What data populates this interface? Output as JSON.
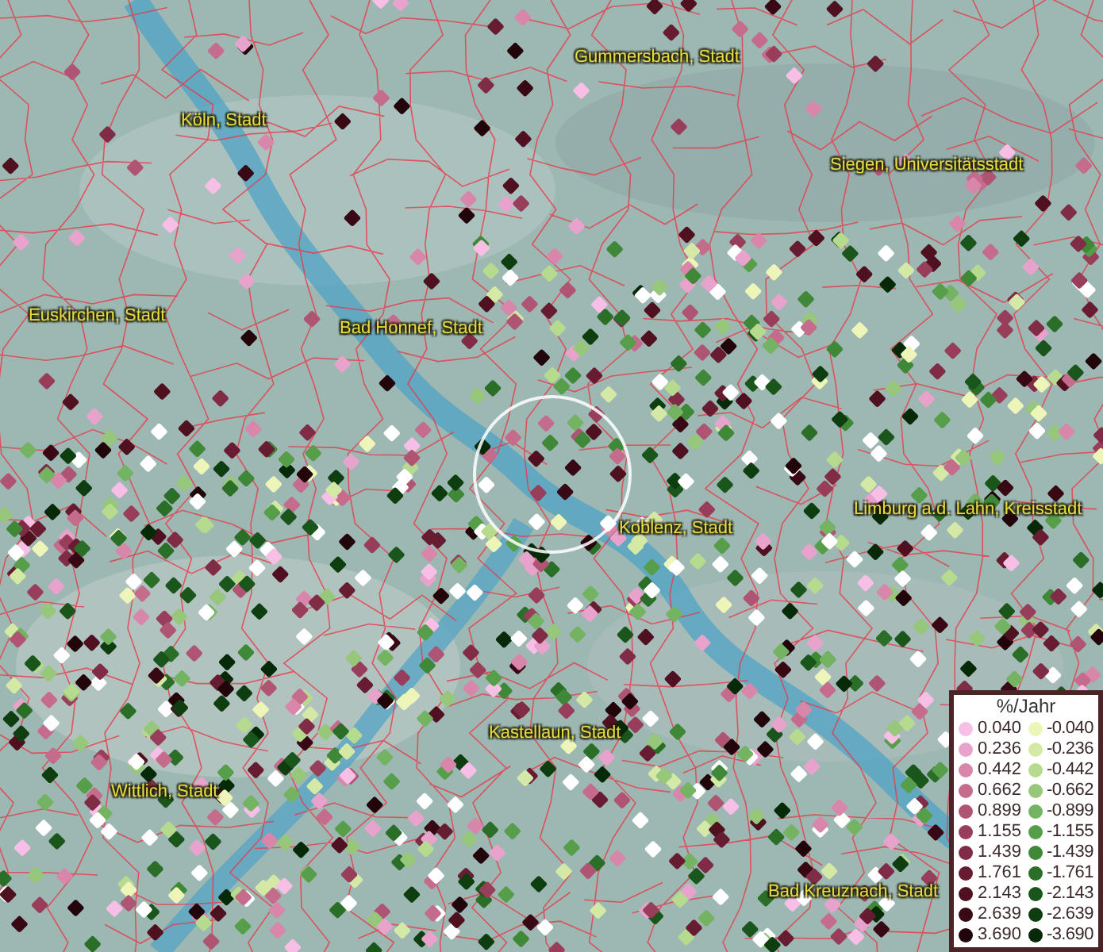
{
  "cities": [
    {
      "label": "Gummersbach, Stadt"
    },
    {
      "label": "Köln, Stadt"
    },
    {
      "label": "Siegen, Universitätsstadt"
    },
    {
      "label": "Euskirchen, Stadt"
    },
    {
      "label": "Bad Honnef, Stadt"
    },
    {
      "label": "Limburg a.d. Lahn, Kreisstadt"
    },
    {
      "label": "Koblenz, Stadt"
    },
    {
      "label": "Kastellaun, Stadt"
    },
    {
      "label": "Wittlich, Stadt"
    },
    {
      "label": "Bad Kreuznach, Stadt"
    }
  ],
  "legend": {
    "title": "%/Jahr",
    "positive": [
      {
        "value": "0.040",
        "color": "#f7bfe6"
      },
      {
        "value": "0.236",
        "color": "#e8a3cc"
      },
      {
        "value": "0.442",
        "color": "#d887ab"
      },
      {
        "value": "0.662",
        "color": "#c56c8c"
      },
      {
        "value": "0.899",
        "color": "#b05473"
      },
      {
        "value": "1.155",
        "color": "#983e5b"
      },
      {
        "value": "1.439",
        "color": "#802c46"
      },
      {
        "value": "1.761",
        "color": "#671c32"
      },
      {
        "value": "2.143",
        "color": "#4f1020"
      },
      {
        "value": "2.639",
        "color": "#380815"
      },
      {
        "value": "3.690",
        "color": "#22040b"
      }
    ],
    "negative": [
      {
        "value": "-0.040",
        "color": "#eef5b8"
      },
      {
        "value": "-0.236",
        "color": "#d5e9a6"
      },
      {
        "value": "-0.442",
        "color": "#b6da8e"
      },
      {
        "value": "-0.662",
        "color": "#96c77a"
      },
      {
        "value": "-0.899",
        "color": "#74b362"
      },
      {
        "value": "-1.155",
        "color": "#569e4a"
      },
      {
        "value": "-1.439",
        "color": "#3e8838"
      },
      {
        "value": "-1.761",
        "color": "#2a6e28"
      },
      {
        "value": "-2.143",
        "color": "#1a561b"
      },
      {
        "value": "-2.639",
        "color": "#0e3e10"
      },
      {
        "value": "-3.690",
        "color": "#062a08"
      }
    ]
  }
}
